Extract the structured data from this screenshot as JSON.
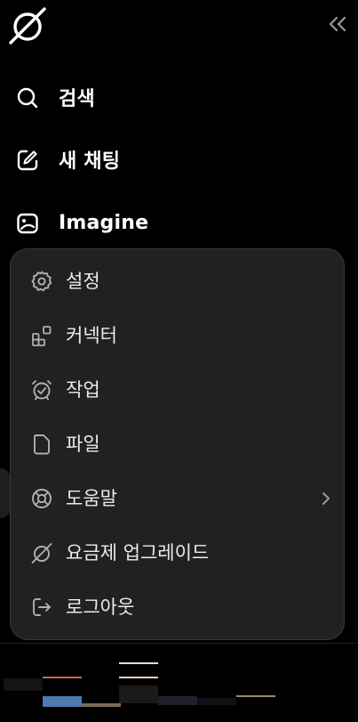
{
  "nav": {
    "search_label": "검색",
    "new_chat_label": "새 채팅",
    "imagine_label": "Imagine"
  },
  "menu": {
    "items": [
      {
        "label": "설정",
        "icon": "gear-icon"
      },
      {
        "label": "커넥터",
        "icon": "connectors-icon"
      },
      {
        "label": "작업",
        "icon": "alarm-check-icon"
      },
      {
        "label": "파일",
        "icon": "file-icon"
      },
      {
        "label": "도움말",
        "icon": "lifebuoy-icon"
      },
      {
        "label": "요금제 업그레이드",
        "icon": "grok-logo-icon"
      },
      {
        "label": "로그아웃",
        "icon": "logout-icon"
      }
    ]
  },
  "colors": {
    "background": "#000000",
    "menu_bg": "#212121",
    "menu_border": "#383838",
    "text": "#ffffff",
    "icon_muted": "#a8a8a8"
  }
}
